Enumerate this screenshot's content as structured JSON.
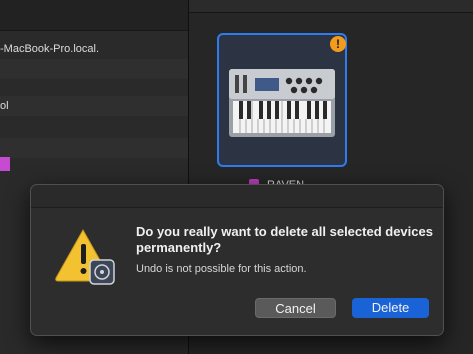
{
  "sidebar": {
    "rows": [
      {
        "label": "-MacBook-Pro.local."
      },
      {
        "label": ""
      },
      {
        "label": ""
      },
      {
        "label": "ol"
      },
      {
        "label": ""
      },
      {
        "label": ""
      },
      {
        "label": ""
      }
    ]
  },
  "device": {
    "name": "RAVEN",
    "warning_symbol": "!",
    "icon": "midi-keyboard-icon",
    "label_color": "#b93bb9"
  },
  "dialog": {
    "title": "Do you really want to delete all selected devices permanently?",
    "info": "Undo is not possible for this action.",
    "icon": "warning-icon",
    "cancel_label": "Cancel",
    "delete_label": "Delete"
  },
  "colors": {
    "accent": "#2f7bf0",
    "warning": "#f39c1b",
    "primary_button": "#1a63d6"
  }
}
